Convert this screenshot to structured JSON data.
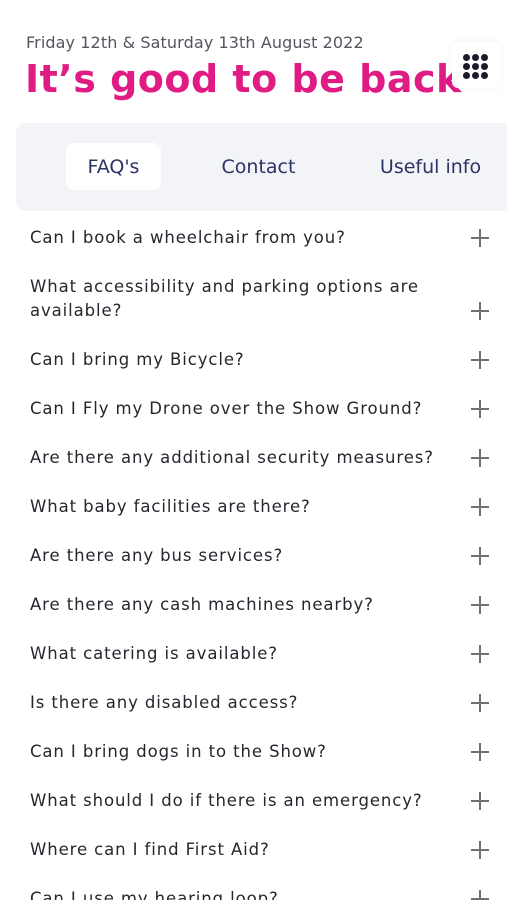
{
  "header": {
    "date": "Friday 12th & Saturday 13th August 2022",
    "title": "It’s good to be back",
    "accent_color": "#e01b84"
  },
  "menu": {
    "icon": "grid-menu-icon"
  },
  "tabs": [
    {
      "label": "FAQ's",
      "active": true
    },
    {
      "label": "Contact",
      "active": false
    },
    {
      "label": "Useful info",
      "active": false
    }
  ],
  "faqs": [
    {
      "question": "Can I book a wheelchair from you?"
    },
    {
      "question": "What accessibility and parking options are available?"
    },
    {
      "question": "Can I bring my Bicycle?"
    },
    {
      "question": "Can I Fly my Drone over the Show Ground?"
    },
    {
      "question": "Are there any additional security measures?"
    },
    {
      "question": "What baby facilities are there?"
    },
    {
      "question": "Are there any bus services?"
    },
    {
      "question": "Are there any cash machines nearby?"
    },
    {
      "question": "What catering is available?"
    },
    {
      "question": "Is there any disabled access?"
    },
    {
      "question": "Can I bring dogs in to the Show?"
    },
    {
      "question": "What should I do if there is an emergency?"
    },
    {
      "question": "Where can I find First Aid?"
    },
    {
      "question": "Can I use my hearing loop?"
    }
  ],
  "expand_icon": "plus-icon"
}
